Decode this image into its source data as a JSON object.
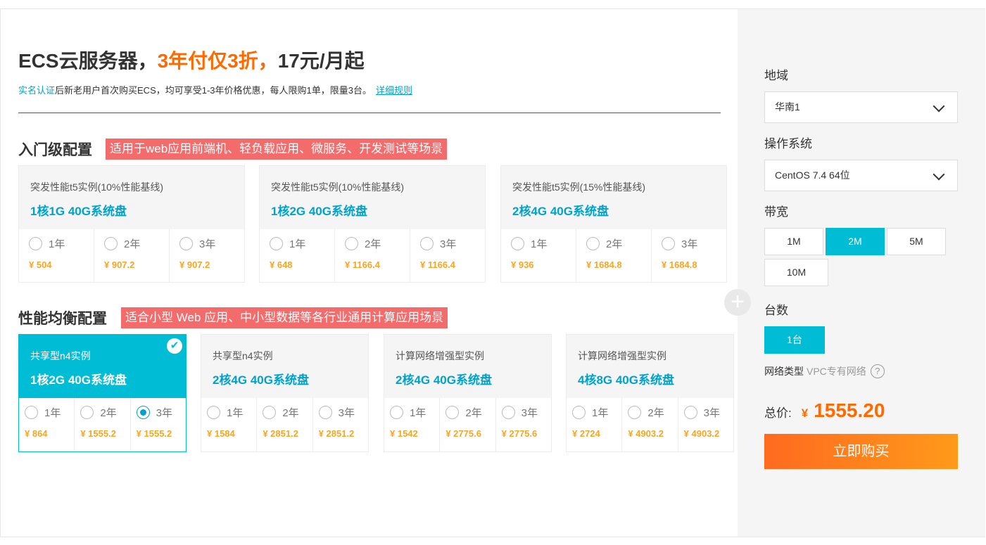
{
  "hero": {
    "title_prefix": "ECS云服务器，",
    "title_highlight": "3年付仅3折，",
    "title_suffix": "17元/月起",
    "auth_link": "实名认证",
    "description": "后新老用户首次购买ECS，均可享受1-3年价格优惠，每人限购1单，限量3台。",
    "rules_link": "详细规则"
  },
  "entry": {
    "title": "入门级配置",
    "tag": "适用于web应用前端机、轻负载应用、微服务、开发测试等场景",
    "cards": [
      {
        "type": "突发性能t5实例(10%性能基线)",
        "spec": "1核1G 40G系统盘",
        "options": [
          {
            "label": "1年",
            "price": "¥ 504"
          },
          {
            "label": "2年",
            "price": "¥ 907.2"
          },
          {
            "label": "3年",
            "price": "¥ 907.2"
          }
        ]
      },
      {
        "type": "突发性能t5实例(10%性能基线)",
        "spec": "1核2G 40G系统盘",
        "options": [
          {
            "label": "1年",
            "price": "¥ 648"
          },
          {
            "label": "2年",
            "price": "¥ 1166.4"
          },
          {
            "label": "3年",
            "price": "¥ 1166.4"
          }
        ]
      },
      {
        "type": "突发性能t5实例(15%性能基线)",
        "spec": "2核4G 40G系统盘",
        "options": [
          {
            "label": "1年",
            "price": "¥ 936"
          },
          {
            "label": "2年",
            "price": "¥ 1684.8"
          },
          {
            "label": "3年",
            "price": "¥ 1684.8"
          }
        ]
      }
    ]
  },
  "balanced": {
    "title": "性能均衡配置",
    "tag": "适合小型 Web 应用、中小型数据等各行业通用计算应用场景",
    "cards": [
      {
        "type": "共享型n4实例",
        "spec": "1核2G 40G系统盘",
        "options": [
          {
            "label": "1年",
            "price": "¥ 864"
          },
          {
            "label": "2年",
            "price": "¥ 1555.2"
          },
          {
            "label": "3年",
            "price": "¥ 1555.2"
          }
        ]
      },
      {
        "type": "共享型n4实例",
        "spec": "2核4G 40G系统盘",
        "options": [
          {
            "label": "1年",
            "price": "¥ 1584"
          },
          {
            "label": "2年",
            "price": "¥ 2851.2"
          },
          {
            "label": "3年",
            "price": "¥ 2851.2"
          }
        ]
      },
      {
        "type": "计算网络增强型实例",
        "spec": "2核4G 40G系统盘",
        "options": [
          {
            "label": "1年",
            "price": "¥ 1542"
          },
          {
            "label": "2年",
            "price": "¥ 2775.6"
          },
          {
            "label": "3年",
            "price": "¥ 2775.6"
          }
        ]
      },
      {
        "type": "计算网络增强型实例",
        "spec": "4核8G 40G系统盘",
        "options": [
          {
            "label": "1年",
            "price": "¥ 2724"
          },
          {
            "label": "2年",
            "price": "¥ 4903.2"
          },
          {
            "label": "3年",
            "price": "¥ 4903.2"
          }
        ]
      }
    ]
  },
  "icons": {
    "selected_check": "check-circle-icon",
    "plus": "plus-icon",
    "chevron": "chevron-down-icon",
    "help": "question-circle-icon"
  },
  "colors": {
    "accent": "#00bcd4",
    "link": "#00a2ca",
    "price": "#f5a623",
    "orange": "#ff6a00",
    "tag_bg": "#f46b6b"
  },
  "sidebar": {
    "region_label": "地域",
    "region_value": "华南1",
    "os_label": "操作系统",
    "os_value": "CentOS 7.4 64位",
    "bandwidth_label": "带宽",
    "bandwidth_options": [
      "1M",
      "2M",
      "5M",
      "10M"
    ],
    "bandwidth_selected": "2M",
    "count_label": "台数",
    "count_value": "1台",
    "network_label": "网络类型",
    "network_value": "VPC专有网络",
    "help_glyph": "?",
    "total_label": "总价:",
    "currency": "¥",
    "total_amount": "1555.20",
    "buy_label": "立即购买"
  },
  "selection": {
    "card": "balanced-0",
    "period": "3年"
  }
}
